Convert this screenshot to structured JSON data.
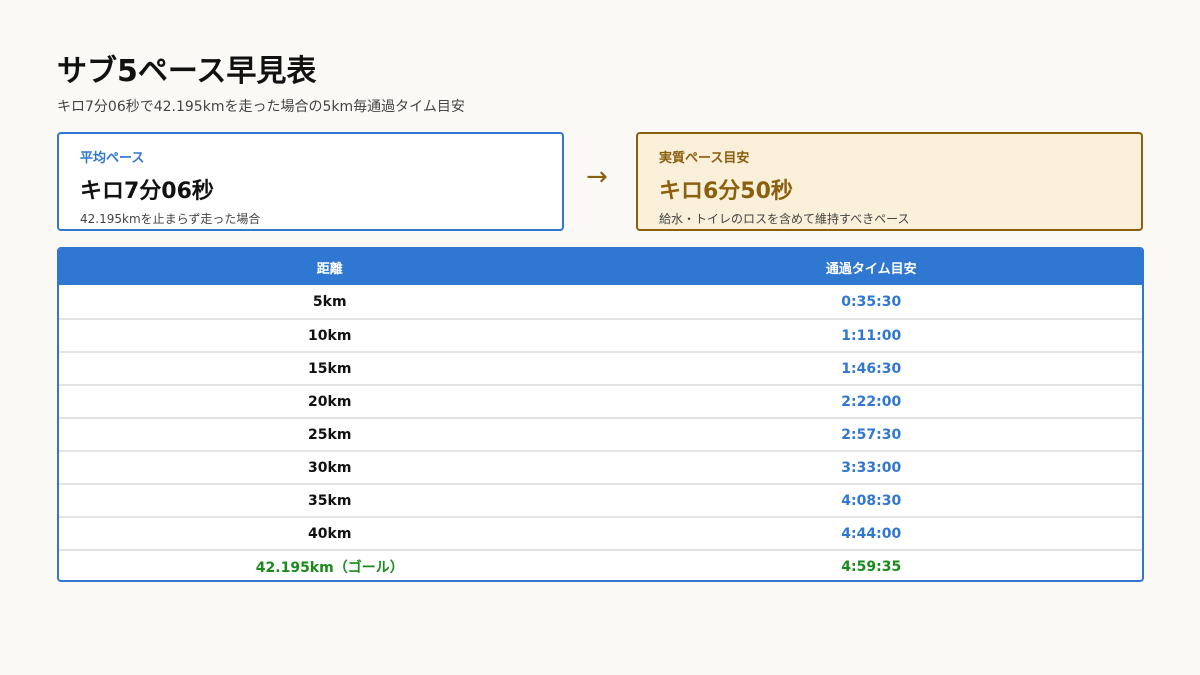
{
  "page": {
    "title": "サブ5ペース早見表",
    "subtitle": "キロ7分06秒で42.195kmを走った場合の5km毎通過タイム目安"
  },
  "cards": {
    "left": {
      "label": "平均ペース",
      "value": "キロ7分06秒",
      "note": "42.195kmを止まらず走った場合"
    },
    "arrow": "→",
    "right": {
      "label": "実質ペース目安",
      "value": "キロ6分50秒",
      "note": "給水・トイレのロスを含めて維持すべきペース"
    }
  },
  "table": {
    "headers": {
      "distance": "距離",
      "time": "通過タイム目安"
    },
    "rows": [
      {
        "distance": "5km",
        "time": "0:35:30"
      },
      {
        "distance": "10km",
        "time": "1:11:00"
      },
      {
        "distance": "15km",
        "time": "1:46:30"
      },
      {
        "distance": "20km",
        "time": "2:22:00"
      },
      {
        "distance": "25km",
        "time": "2:57:30"
      },
      {
        "distance": "30km",
        "time": "3:33:00"
      },
      {
        "distance": "35km",
        "time": "4:08:30"
      },
      {
        "distance": "40km",
        "time": "4:44:00"
      },
      {
        "distance": "42.195km（ゴール）",
        "time": "4:59:35"
      }
    ]
  },
  "colors": {
    "accent_blue": "#2f77d0",
    "accent_brown": "#8a5f0e",
    "goal_green": "#1a8a1a",
    "card_right_bg": "#faefd8"
  }
}
